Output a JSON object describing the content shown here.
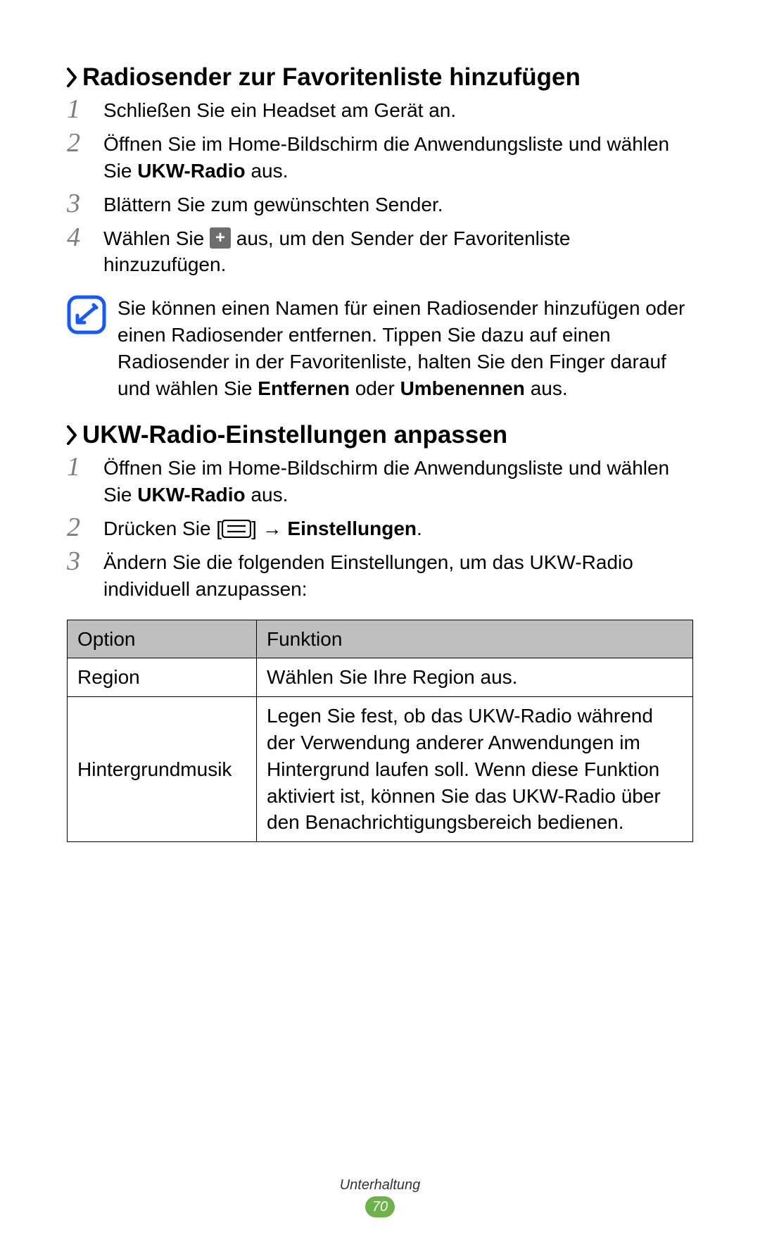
{
  "section1": {
    "title": "Radiosender zur Favoritenliste hinzufügen",
    "steps": {
      "s1": "Schließen Sie ein Headset am Gerät an.",
      "s2_a": "Öffnen Sie im Home-Bildschirm die Anwendungsliste und wählen Sie ",
      "s2_b": "UKW-Radio",
      "s2_c": " aus.",
      "s3": "Blättern Sie zum gewünschten Sender.",
      "s4_a": "Wählen Sie ",
      "s4_b": " aus, um den Sender der Favoritenliste hinzuzufügen."
    },
    "note_a": "Sie können einen Namen für einen Radiosender hinzufügen oder einen Radiosender entfernen. Tippen Sie dazu auf einen Radiosender in der Favoritenliste, halten Sie den Finger darauf und wählen Sie ",
    "note_b": "Entfernen",
    "note_c": " oder ",
    "note_d": "Umbenennen",
    "note_e": " aus."
  },
  "section2": {
    "title": "UKW-Radio-Einstellungen anpassen",
    "steps": {
      "s1_a": "Öffnen Sie im Home-Bildschirm die Anwendungsliste und wählen Sie ",
      "s1_b": "UKW-Radio",
      "s1_c": " aus.",
      "s2_a": "Drücken Sie [",
      "s2_b": "] → ",
      "s2_c": "Einstellungen",
      "s2_d": ".",
      "s3": "Ändern Sie die folgenden Einstellungen, um das UKW-Radio individuell anzupassen:"
    },
    "table": {
      "hdr_option": "Option",
      "hdr_function": "Funktion",
      "rows": [
        {
          "opt": "Region",
          "fn": "Wählen Sie Ihre Region aus."
        },
        {
          "opt": "Hintergrundmusik",
          "fn": "Legen Sie fest, ob das UKW-Radio während der Verwendung anderer Anwendungen im Hintergrund laufen soll. Wenn diese Funktion aktiviert ist, können Sie das UKW-Radio über den Benachrichtigungsbereich bedienen."
        }
      ]
    }
  },
  "footer": {
    "section": "Unterhaltung",
    "page": "70"
  },
  "icons": {
    "plus": "+"
  }
}
